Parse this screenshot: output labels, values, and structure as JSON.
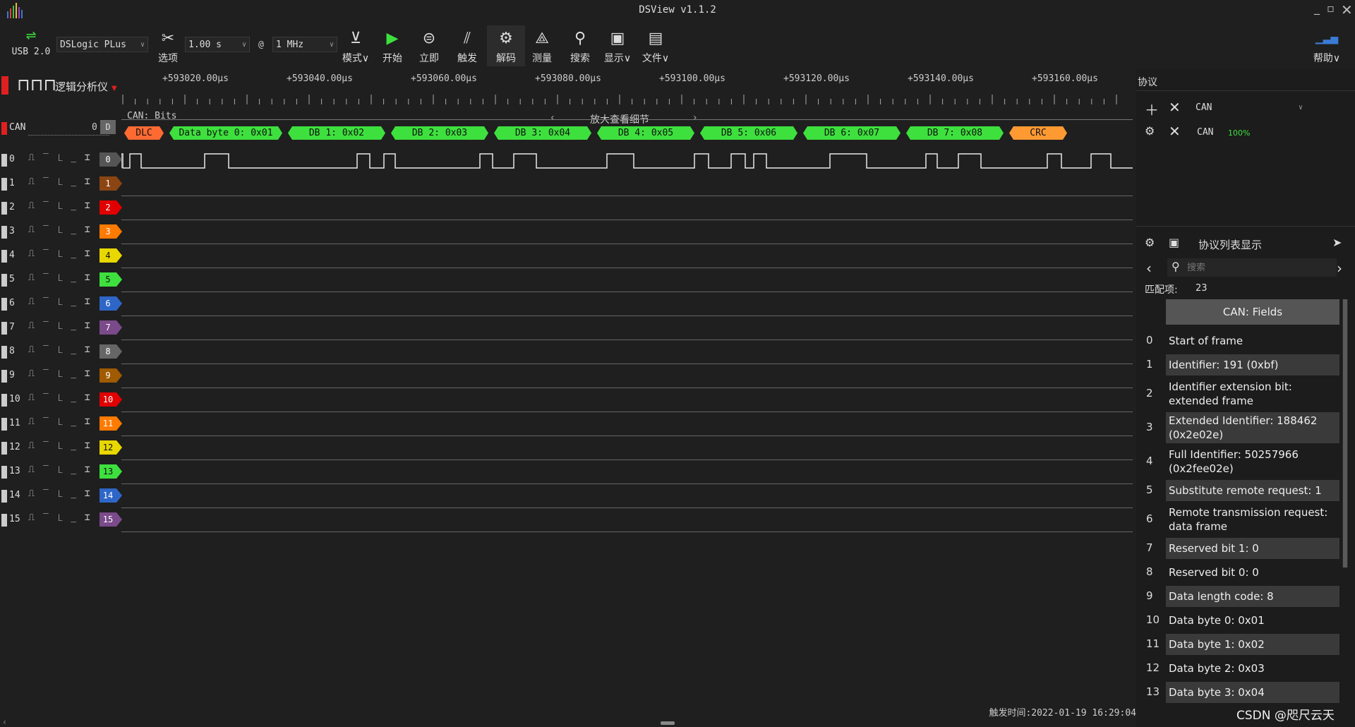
{
  "app": {
    "title": "DSView v1.1.2",
    "usb_label": "USB 2.0",
    "device_select": "DSLogic PLus",
    "duration_select": "1.00 s",
    "at_symbol": "@",
    "rate_select": "1 MHz"
  },
  "toolbar": {
    "options": "选项",
    "mode": "模式∨",
    "start": "开始",
    "instant": "立即",
    "trigger": "触发",
    "decode": "解码",
    "measure": "测量",
    "search": "搜索",
    "display": "显示∨",
    "file": "文件∨",
    "help": "帮助∨"
  },
  "view": {
    "mode_label": "逻辑分析仪",
    "ruler": [
      "+593020.00μs",
      "+593040.00μs",
      "+593060.00μs",
      "+593080.00μs",
      "+593100.00μs",
      "+593120.00μs",
      "+593140.00μs",
      "+593160.00μs"
    ],
    "zoom_hint": "放大查看细节",
    "decoder_name": "CAN",
    "decoder_chan": "0",
    "decoder_tag": "D",
    "decoder_row_title": "CAN: Bits",
    "trigger_time": "触发时间:2022-01-19 16:29:04"
  },
  "frames": [
    {
      "label": "DLC",
      "color": "#ff6a33"
    },
    {
      "label": "Data byte 0: 0x01",
      "color": "#3ee03e"
    },
    {
      "label": "DB 1: 0x02",
      "color": "#3ee03e"
    },
    {
      "label": "DB 2: 0x03",
      "color": "#3ee03e"
    },
    {
      "label": "DB 3: 0x04",
      "color": "#3ee03e"
    },
    {
      "label": "DB 4: 0x05",
      "color": "#3ee03e"
    },
    {
      "label": "DB 5: 0x06",
      "color": "#3ee03e"
    },
    {
      "label": "DB 6: 0x07",
      "color": "#3ee03e"
    },
    {
      "label": "DB 7: 0x08",
      "color": "#3ee03e"
    },
    {
      "label": "CRC",
      "color": "#ff9a33"
    }
  ],
  "channels": [
    {
      "name": "0",
      "color": "#555555"
    },
    {
      "name": "1",
      "color": "#8b4513"
    },
    {
      "name": "2",
      "color": "#e00000"
    },
    {
      "name": "3",
      "color": "#ff7a00"
    },
    {
      "name": "4",
      "color": "#e8d800"
    },
    {
      "name": "5",
      "color": "#3ee03e"
    },
    {
      "name": "6",
      "color": "#2e66c8"
    },
    {
      "name": "7",
      "color": "#7a4a8a"
    },
    {
      "name": "8",
      "color": "#666666"
    },
    {
      "name": "9",
      "color": "#a05a00"
    },
    {
      "name": "10",
      "color": "#e00000"
    },
    {
      "name": "11",
      "color": "#ff7a00"
    },
    {
      "name": "12",
      "color": "#e8d800"
    },
    {
      "name": "13",
      "color": "#3ee03e"
    },
    {
      "name": "14",
      "color": "#2e66c8"
    },
    {
      "name": "15",
      "color": "#7a4a8a"
    }
  ],
  "trigger_glyphs": "⎍ ‾ ⎿ _ ⌶",
  "panel": {
    "title": "协议",
    "protocol_select": "CAN",
    "protocol_name": "CAN",
    "protocol_progress": "100%",
    "list_title": "协议列表显示",
    "search_placeholder": "搜索",
    "match_label": "匹配项:",
    "match_count": "23",
    "table_header": "CAN: Fields",
    "fields": [
      {
        "idx": "0",
        "text": "Start of frame"
      },
      {
        "idx": "1",
        "text": "Identifier: 191 (0xbf)"
      },
      {
        "idx": "2",
        "text": "Identifier extension bit: extended frame"
      },
      {
        "idx": "3",
        "text": "Extended Identifier: 188462 (0x2e02e)"
      },
      {
        "idx": "4",
        "text": "Full Identifier: 50257966 (0x2fee02e)"
      },
      {
        "idx": "5",
        "text": "Substitute remote request: 1"
      },
      {
        "idx": "6",
        "text": "Remote transmission request: data frame"
      },
      {
        "idx": "7",
        "text": "Reserved bit 1: 0"
      },
      {
        "idx": "8",
        "text": "Reserved bit 0: 0"
      },
      {
        "idx": "9",
        "text": "Data length code: 8"
      },
      {
        "idx": "10",
        "text": "Data byte 0: 0x01"
      },
      {
        "idx": "11",
        "text": "Data byte 1: 0x02"
      },
      {
        "idx": "12",
        "text": "Data byte 2: 0x03"
      },
      {
        "idx": "13",
        "text": "Data byte 3: 0x04"
      }
    ]
  },
  "watermark": "CSDN @咫尺云天"
}
